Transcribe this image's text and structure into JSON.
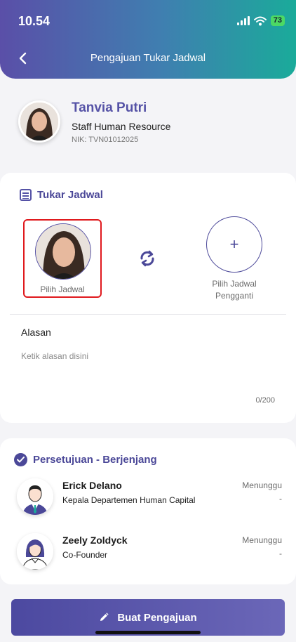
{
  "status_bar": {
    "time": "10.54",
    "battery": "73"
  },
  "header": {
    "title": "Pengajuan Tukar Jadwal"
  },
  "profile": {
    "name": "Tanvia Putri",
    "role": "Staff Human Resource",
    "nik": "NIK: TVN01012025"
  },
  "swap": {
    "section_title": "Tukar Jadwal",
    "left_label": "Pilih Jadwal",
    "right_label_line1": "Pilih Jadwal",
    "right_label_line2": "Pengganti",
    "add_glyph": "+"
  },
  "reason": {
    "label": "Alasan",
    "placeholder": "Ketik alasan disini",
    "counter": "0/200"
  },
  "approval": {
    "section_title": "Persetujuan - Berjenjang",
    "approvers": [
      {
        "name": "Erick Delano",
        "role": "Kepala Departemen Human Capital",
        "status": "Menunggu",
        "note": "-"
      },
      {
        "name": "Zeely Zoldyck",
        "role": "Co-Founder",
        "status": "Menunggu",
        "note": "-"
      }
    ]
  },
  "submit": {
    "label": "Buat Pengajuan"
  },
  "colors": {
    "primary": "#4b4898",
    "accent_teal": "#1aab9a",
    "highlight_red": "#e0191d"
  },
  "icons": [
    "back-arrow-icon",
    "list-icon",
    "swap-icon",
    "plus-icon",
    "check-icon",
    "pencil-icon"
  ]
}
